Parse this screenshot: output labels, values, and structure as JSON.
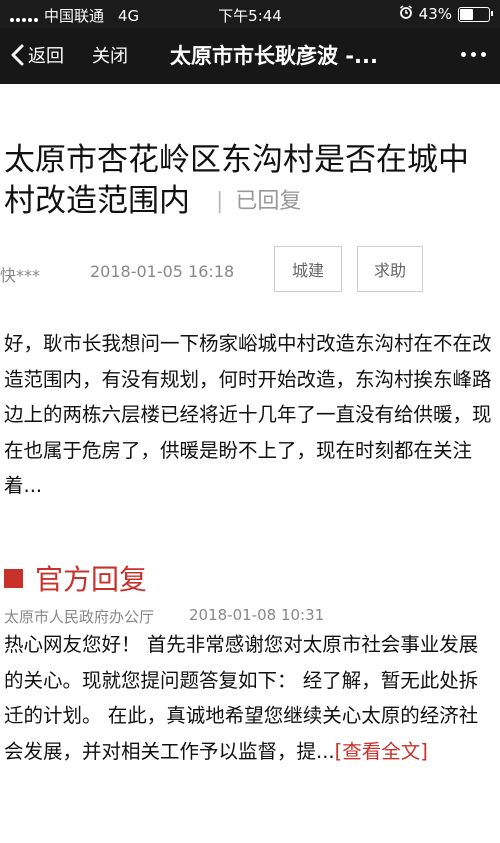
{
  "status_bar": {
    "carrier": "中国联通",
    "network": "4G",
    "time": "下午5:44",
    "battery": "43%",
    "battery_level": 0.43
  },
  "nav": {
    "back_label": "返回",
    "close_label": "关闭",
    "title": "太原市市长耿彦波 -..."
  },
  "post": {
    "title": "太原市杏花岭区东沟村是否在城中村改造范围内",
    "separator": "|",
    "status": "已回复",
    "author": "快***",
    "datetime": "2018-01-05 16:18",
    "tags": [
      "城建",
      "求助"
    ],
    "body": "好，耿市长我想问一下杨家峪城中村改造东沟村在不在改造范围内，有没有规划，何时开始改造，东沟村挨东峰路边上的两栋六层楼已经将近十几年了一直没有给供暖，现在也属于危房了，供暖是盼不上了，现在时刻都在关注着..."
  },
  "reply": {
    "heading": "官方回复",
    "department": "太原市人民政府办公厅",
    "datetime": "2018-01-08 10:31",
    "text": "热心网友您好！ 首先非常感谢您对太原市社会事业发展的关心。现就您提问题答复如下： 经了解，暂无此处拆迁的计划。 在此，真诚地希望您继续关心太原的经济社会发展，并对相关工作予以监督，提...",
    "more_link": "[查看全文]",
    "accent_color": "#c8322b"
  }
}
